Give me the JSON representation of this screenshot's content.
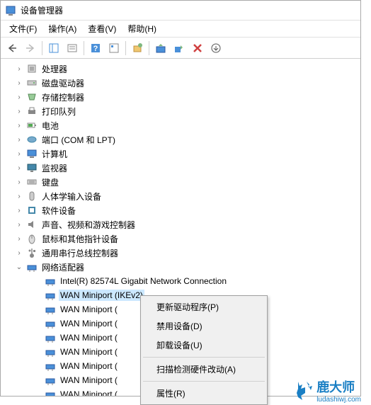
{
  "window": {
    "title": "设备管理器"
  },
  "menubar": {
    "file": "文件(F)",
    "action": "操作(A)",
    "view": "查看(V)",
    "help": "帮助(H)"
  },
  "tree": {
    "items": [
      {
        "label": "处理器",
        "icon": "cpu"
      },
      {
        "label": "磁盘驱动器",
        "icon": "disk"
      },
      {
        "label": "存储控制器",
        "icon": "storage"
      },
      {
        "label": "打印队列",
        "icon": "printer"
      },
      {
        "label": "电池",
        "icon": "battery"
      },
      {
        "label": "端口 (COM 和 LPT)",
        "icon": "port"
      },
      {
        "label": "计算机",
        "icon": "computer"
      },
      {
        "label": "监视器",
        "icon": "monitor"
      },
      {
        "label": "键盘",
        "icon": "keyboard"
      },
      {
        "label": "人体学输入设备",
        "icon": "hid"
      },
      {
        "label": "软件设备",
        "icon": "software"
      },
      {
        "label": "声音、视频和游戏控制器",
        "icon": "audio"
      },
      {
        "label": "鼠标和其他指针设备",
        "icon": "mouse"
      },
      {
        "label": "通用串行总线控制器",
        "icon": "usb"
      }
    ],
    "network": {
      "label": "网络适配器",
      "children": [
        "Intel(R) 82574L Gigabit Network Connection",
        "WAN Miniport (IKEv2)",
        "WAN Miniport (",
        "WAN Miniport (",
        "WAN Miniport (",
        "WAN Miniport (",
        "WAN Miniport (",
        "WAN Miniport (",
        "WAN Miniport ("
      ]
    }
  },
  "context_menu": {
    "update_driver": "更新驱动程序(P)",
    "disable": "禁用设备(D)",
    "uninstall": "卸载设备(U)",
    "scan": "扫描检测硬件改动(A)",
    "properties": "属性(R)"
  },
  "watermark": {
    "name": "鹿大师",
    "url": "ludashiwj.com"
  }
}
